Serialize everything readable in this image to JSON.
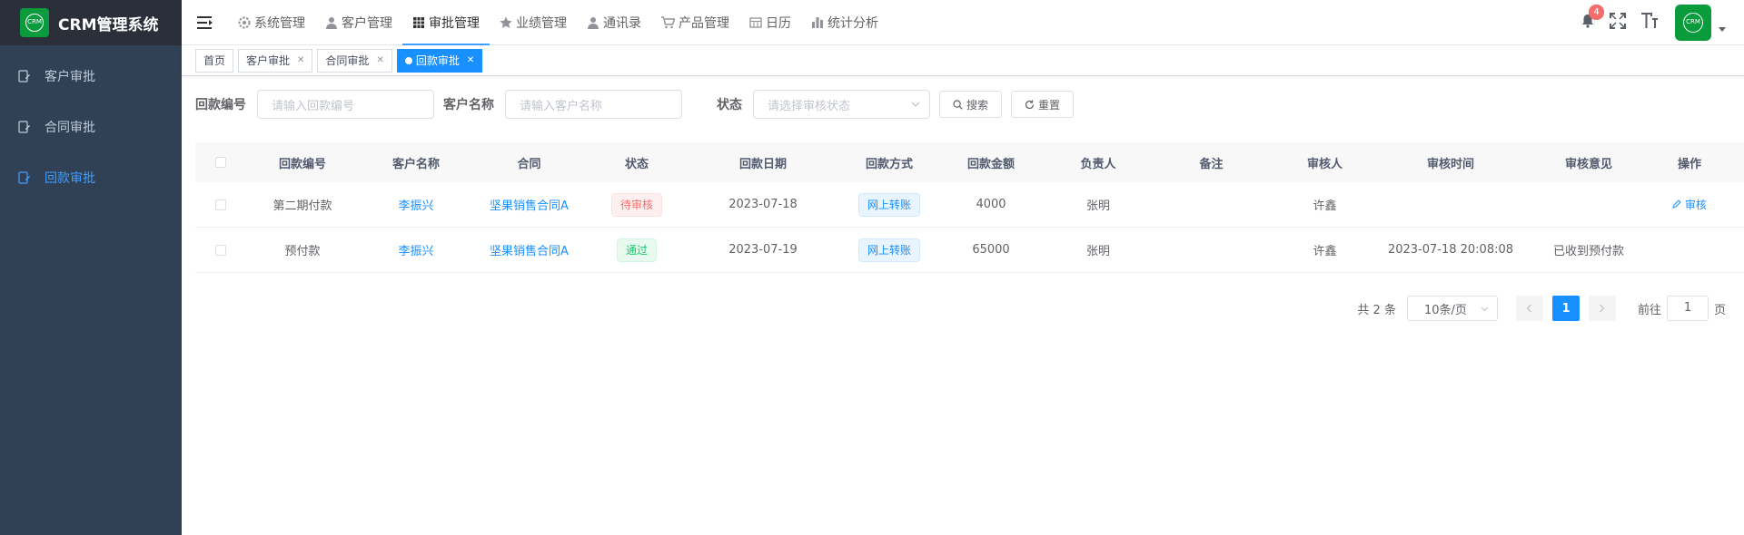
{
  "app": {
    "title": "CRM管理系统",
    "logo_text": "CRM"
  },
  "sidebar": {
    "items": [
      {
        "label": "客户审批",
        "active": false,
        "icon": "approval-doc-icon"
      },
      {
        "label": "合同审批",
        "active": false,
        "icon": "approval-doc-icon"
      },
      {
        "label": "回款审批",
        "active": true,
        "icon": "approval-doc-icon"
      }
    ]
  },
  "topnav": {
    "items": [
      {
        "label": "系统管理",
        "icon": "gear-icon"
      },
      {
        "label": "客户管理",
        "icon": "user-icon"
      },
      {
        "label": "审批管理",
        "icon": "grid-icon",
        "active": true
      },
      {
        "label": "业绩管理",
        "icon": "star-icon"
      },
      {
        "label": "通讯录",
        "icon": "user-icon"
      },
      {
        "label": "产品管理",
        "icon": "cart-icon"
      },
      {
        "label": "日历",
        "icon": "calendar-icon"
      },
      {
        "label": "统计分析",
        "icon": "bar-chart-icon"
      }
    ],
    "notification_count": "4",
    "avatar_text": "CRM"
  },
  "tags": [
    {
      "label": "首页",
      "closable": false
    },
    {
      "label": "客户审批",
      "closable": true
    },
    {
      "label": "合同审批",
      "closable": true
    },
    {
      "label": "回款审批",
      "closable": true,
      "active": true
    }
  ],
  "search": {
    "payment_no_label": "回款编号",
    "payment_no_placeholder": "请输入回款编号",
    "customer_label": "客户名称",
    "customer_placeholder": "请输入客户名称",
    "status_label": "状态",
    "status_placeholder": "请选择审核状态",
    "search_button": "搜索",
    "reset_button": "重置"
  },
  "table": {
    "columns": [
      "回款编号",
      "客户名称",
      "合同",
      "状态",
      "回款日期",
      "回款方式",
      "回款金额",
      "负责人",
      "备注",
      "审核人",
      "审核时间",
      "审核意见",
      "操作"
    ],
    "rows": [
      {
        "no": "第二期付款",
        "customer": "李振兴",
        "contract": "坚果销售合同A",
        "status": "待审核",
        "status_type": "pending",
        "date": "2023-07-18",
        "method": "网上转账",
        "amount": "4000",
        "owner": "张明",
        "remark": "",
        "auditor": "许鑫",
        "audit_time": "",
        "opinion": "",
        "action": "审核"
      },
      {
        "no": "预付款",
        "customer": "李振兴",
        "contract": "坚果销售合同A",
        "status": "通过",
        "status_type": "pass",
        "date": "2023-07-19",
        "method": "网上转账",
        "amount": "65000",
        "owner": "张明",
        "remark": "",
        "auditor": "许鑫",
        "audit_time": "2023-07-18 20:08:08",
        "opinion": "已收到预付款",
        "action": ""
      }
    ]
  },
  "pagination": {
    "total_text": "共 2 条",
    "page_size": "10条/页",
    "current_page": "1",
    "goto_label": "前往",
    "goto_value": "1",
    "page_suffix": "页"
  },
  "colors": {
    "sidebar_bg": "#304156",
    "accent": "#1890ff",
    "logo_green": "#0a9b3c"
  }
}
